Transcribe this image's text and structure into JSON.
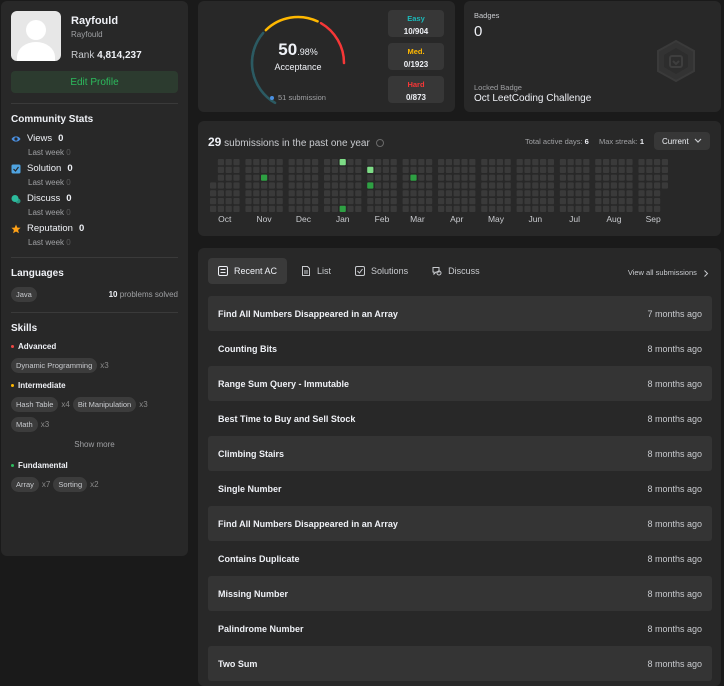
{
  "profile": {
    "name": "Rayfould",
    "username": "Rayfould",
    "rank_label": "Rank",
    "rank": "4,814,237",
    "edit_label": "Edit Profile"
  },
  "community": {
    "title": "Community Stats",
    "items": [
      {
        "label": "Views",
        "value": "0",
        "sub": "Last week",
        "sub_value": "0",
        "icon": "eye-icon",
        "color": "#4a90e2"
      },
      {
        "label": "Solution",
        "value": "0",
        "sub": "Last week",
        "sub_value": "0",
        "icon": "checkbox-icon",
        "color": "#4fa3e0"
      },
      {
        "label": "Discuss",
        "value": "0",
        "sub": "Last week",
        "sub_value": "0",
        "icon": "discuss-icon",
        "color": "#2cbb9d"
      },
      {
        "label": "Reputation",
        "value": "0",
        "sub": "Last week",
        "sub_value": "0",
        "icon": "star-icon",
        "color": "#ffa116"
      }
    ]
  },
  "languages": {
    "title": "Languages",
    "items": [
      {
        "name": "Java",
        "count": "10",
        "suffix": "problems solved"
      }
    ]
  },
  "skills": {
    "title": "Skills",
    "groups": [
      {
        "name": "Advanced",
        "color": "#ef4743",
        "tags": [
          {
            "name": "Dynamic Programming",
            "count": "x3"
          }
        ]
      },
      {
        "name": "Intermediate",
        "color": "#ffb800",
        "tags": [
          {
            "name": "Hash Table",
            "count": "x4"
          },
          {
            "name": "Bit Manipulation",
            "count": "x3"
          },
          {
            "name": "Math",
            "count": "x3"
          }
        ]
      },
      {
        "name": "Fundamental",
        "color": "#2cbb5d",
        "tags": [
          {
            "name": "Array",
            "count": "x7"
          },
          {
            "name": "Sorting",
            "count": "x2"
          }
        ]
      }
    ],
    "show_more": "Show more"
  },
  "acceptance": {
    "whole": "50",
    "fraction": ".98%",
    "label": "Acceptance",
    "submissions": "51 submission",
    "rate": 0.5098,
    "difficulty": [
      {
        "label": "Easy",
        "value": "10/904",
        "color": "#1cbaba"
      },
      {
        "label": "Med.",
        "value": "0/1923",
        "color": "#ffb800"
      },
      {
        "label": "Hard",
        "value": "0/873",
        "color": "#f63737"
      }
    ]
  },
  "badges": {
    "label": "Badges",
    "count": "0",
    "locked_label": "Locked Badge",
    "locked_name": "Oct LeetCoding Challenge"
  },
  "calendar": {
    "count": "29",
    "title_suffix": "submissions in the past one year",
    "active_label": "Total active days:",
    "active_value": "6",
    "streak_label": "Max streak:",
    "streak_value": "1",
    "select_label": "Current",
    "months": [
      "Oct",
      "Nov",
      "Dec",
      "Jan",
      "Feb",
      "Mar",
      "Apr",
      "May",
      "Jun",
      "Jul",
      "Aug",
      "Sep"
    ],
    "active_cells": [
      {
        "month": 1,
        "col": 2,
        "row": 2,
        "level": 2
      },
      {
        "month": 3,
        "col": 2,
        "row": 0,
        "level": 1
      },
      {
        "month": 3,
        "col": 2,
        "row": 6,
        "level": 2
      },
      {
        "month": 4,
        "col": 0,
        "row": 1,
        "level": 1
      },
      {
        "month": 4,
        "col": 0,
        "row": 3,
        "level": 2
      },
      {
        "month": 5,
        "col": 1,
        "row": 2,
        "level": 2
      }
    ]
  },
  "recent": {
    "tabs": [
      {
        "label": "Recent AC",
        "icon": "list-check-icon",
        "active": true
      },
      {
        "label": "List",
        "icon": "document-icon",
        "active": false
      },
      {
        "label": "Solutions",
        "icon": "check-square-icon",
        "active": false
      },
      {
        "label": "Discuss",
        "icon": "chat-icon",
        "active": false
      }
    ],
    "view_all": "View all submissions",
    "items": [
      {
        "title": "Find All Numbers Disappeared in an Array",
        "ago": "7 months ago"
      },
      {
        "title": "Counting Bits",
        "ago": "8 months ago"
      },
      {
        "title": "Range Sum Query - Immutable",
        "ago": "8 months ago"
      },
      {
        "title": "Best Time to Buy and Sell Stock",
        "ago": "8 months ago"
      },
      {
        "title": "Climbing Stairs",
        "ago": "8 months ago"
      },
      {
        "title": "Single Number",
        "ago": "8 months ago"
      },
      {
        "title": "Find All Numbers Disappeared in an Array",
        "ago": "8 months ago"
      },
      {
        "title": "Contains Duplicate",
        "ago": "8 months ago"
      },
      {
        "title": "Missing Number",
        "ago": "8 months ago"
      },
      {
        "title": "Palindrome Number",
        "ago": "8 months ago"
      },
      {
        "title": "Two Sum",
        "ago": "8 months ago"
      }
    ]
  }
}
